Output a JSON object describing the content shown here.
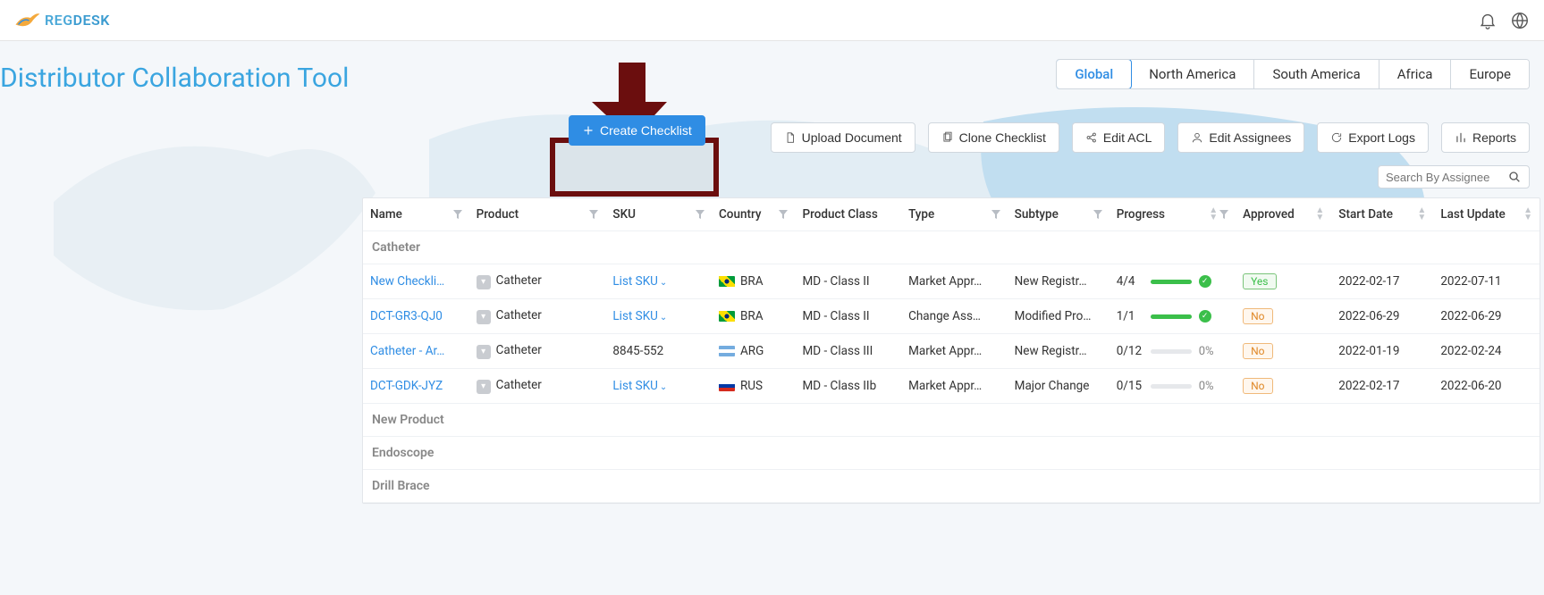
{
  "brand": {
    "name_a": "REG",
    "name_b": "DESK"
  },
  "page_title": "Distributor Collaboration Tool",
  "regions": [
    {
      "label": "Global",
      "active": true
    },
    {
      "label": "North America",
      "active": false
    },
    {
      "label": "South America",
      "active": false
    },
    {
      "label": "Africa",
      "active": false
    },
    {
      "label": "Europe",
      "active": false
    }
  ],
  "actions": {
    "create": "Create Checklist",
    "upload": "Upload Document",
    "clone": "Clone Checklist",
    "acl": "Edit ACL",
    "assignees": "Edit Assignees",
    "export": "Export Logs",
    "reports": "Reports"
  },
  "search": {
    "placeholder": "Search By Assignee"
  },
  "columns": {
    "name": "Name",
    "product": "Product",
    "sku": "SKU",
    "country": "Country",
    "product_class": "Product Class",
    "type": "Type",
    "subtype": "Subtype",
    "progress": "Progress",
    "approved": "Approved",
    "start_date": "Start Date",
    "last_update": "Last Update"
  },
  "groups": {
    "g0": "Catheter",
    "g1": "New Product",
    "g2": "Endoscope",
    "g3": "Drill Brace"
  },
  "rows": [
    {
      "name": "New Checkli…",
      "product": "Catheter",
      "sku_label": "List SKU",
      "sku_is_link": true,
      "country": "BRA",
      "flag": "bra",
      "product_class": "MD - Class II",
      "type": "Market Appr…",
      "subtype": "New Registr…",
      "progress_frac": "4/4",
      "progress_fill": 100,
      "progress_complete": true,
      "approved": "Yes",
      "start_date": "2022-02-17",
      "last_update": "2022-07-11"
    },
    {
      "name": "DCT-GR3-QJ0",
      "product": "Catheter",
      "sku_label": "List SKU",
      "sku_is_link": true,
      "country": "BRA",
      "flag": "bra",
      "product_class": "MD - Class II",
      "type": "Change Ass…",
      "subtype": "Modified Pro…",
      "progress_frac": "1/1",
      "progress_fill": 100,
      "progress_complete": true,
      "approved": "No",
      "start_date": "2022-06-29",
      "last_update": "2022-06-29"
    },
    {
      "name": "Catheter - Ar…",
      "product": "Catheter",
      "sku_label": "8845-552",
      "sku_is_link": false,
      "country": "ARG",
      "flag": "arg",
      "product_class": "MD - Class III",
      "type": "Market Appr…",
      "subtype": "New Registr…",
      "progress_frac": "0/12",
      "progress_fill": 0,
      "progress_complete": false,
      "progress_pct": "0%",
      "approved": "No",
      "start_date": "2022-01-19",
      "last_update": "2022-02-24"
    },
    {
      "name": "DCT-GDK-JYZ",
      "product": "Catheter",
      "sku_label": "List SKU",
      "sku_is_link": true,
      "country": "RUS",
      "flag": "rus",
      "product_class": "MD - Class IIb",
      "type": "Market Appr…",
      "subtype": "Major Change",
      "progress_frac": "0/15",
      "progress_fill": 0,
      "progress_complete": false,
      "progress_pct": "0%",
      "approved": "No",
      "start_date": "2022-02-17",
      "last_update": "2022-06-20"
    }
  ]
}
